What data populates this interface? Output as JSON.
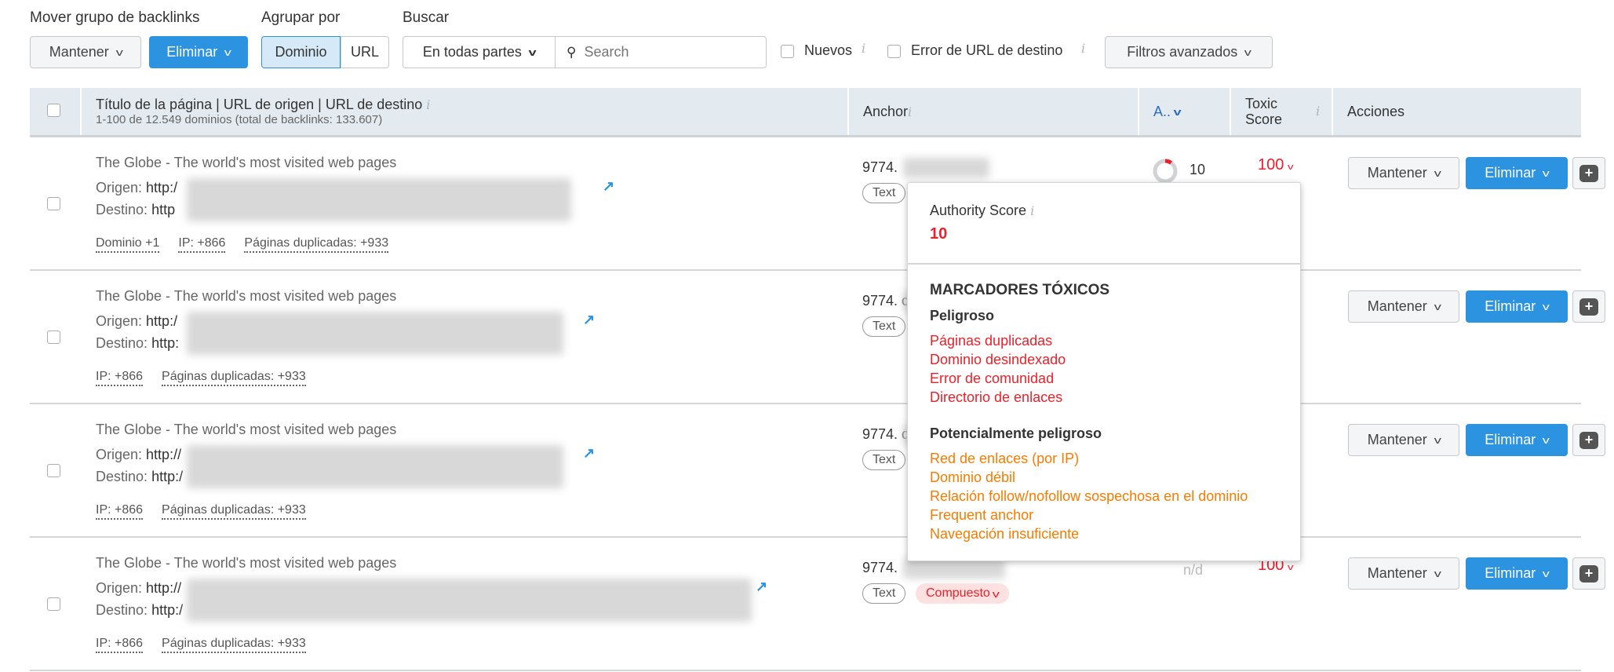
{
  "toolbar": {
    "move_label": "Mover grupo de backlinks",
    "group_label": "Agrupar por",
    "search_label": "Buscar",
    "keep": "Mantener",
    "delete": "Eliminar",
    "group_domain": "Dominio",
    "group_url": "URL",
    "scope": "En todas partes",
    "search_placeholder": "Search",
    "new_label": "Nuevos",
    "dest_error_label": "Error de URL de destino",
    "advanced_filters": "Filtros avanzados"
  },
  "table": {
    "col_title": "Título de la página | URL de origen | URL de destino",
    "col_title_sub": "1-100 de 12.549 dominios (total de backlinks: 133.607)",
    "col_anchor": "Anchor",
    "col_as": "A..",
    "col_toxic": "Toxic Score",
    "col_actions": "Acciones",
    "rows": [
      {
        "title": "The Globe - The world's most visited web pages",
        "origin_label": "Origen:",
        "origin": "http:/",
        "dest_label": "Destino:",
        "dest": "http",
        "tags": [
          "Dominio +1",
          "IP: +866",
          "Páginas duplicadas: +933"
        ],
        "anchor": "9774.",
        "anchor_type": "Text",
        "as": "10",
        "toxic": "100",
        "keep": "Mantener",
        "delete": "Eliminar"
      },
      {
        "title": "The Globe - The world's most visited web pages",
        "origin_label": "Origen:",
        "origin": "http:/",
        "dest_label": "Destino:",
        "dest": "http:",
        "tags": [
          "IP: +866",
          "Páginas duplicadas: +933"
        ],
        "anchor": "9774. c",
        "anchor_type": "Text",
        "keep": "Mantener",
        "delete": "Eliminar"
      },
      {
        "title": "The Globe - The world's most visited web pages",
        "origin_label": "Origen:",
        "origin": "http://",
        "dest_label": "Destino:",
        "dest": "http:/",
        "tags": [
          "IP: +866",
          "Páginas duplicadas: +933"
        ],
        "anchor": "9774. c",
        "anchor_type": "Text",
        "keep": "Mantener",
        "delete": "Eliminar"
      },
      {
        "title": "The Globe - The world's most visited web pages",
        "origin_label": "Origen:",
        "origin": "http://",
        "dest_label": "Destino:",
        "dest": "http:/",
        "tags": [
          "IP: +866",
          "Páginas duplicadas: +933"
        ],
        "anchor": "9774.",
        "anchor_type": "Text",
        "anchor_badge": "Compuesto",
        "as": "n/d",
        "toxic": "100",
        "keep": "Mantener",
        "delete": "Eliminar"
      }
    ]
  },
  "popup": {
    "title": "Authority Score",
    "value": "10",
    "section": "MARCADORES TÓXICOS",
    "dangerous": "Peligroso",
    "dangerous_items": [
      "Páginas duplicadas",
      "Dominio desindexado",
      "Error de comunidad",
      "Directorio de enlaces"
    ],
    "potential": "Potencialmente peligroso",
    "potential_items": [
      "Red de enlaces (por IP)",
      "Dominio débil",
      "Relación follow/nofollow sospechosa en el dominio",
      "Frequent anchor",
      "Navegación insuficiente"
    ]
  },
  "colors": {
    "accent": "#2b93e0",
    "danger": "#e8212b",
    "warning": "#f57c00",
    "header_bg": "#e4ebf0"
  }
}
